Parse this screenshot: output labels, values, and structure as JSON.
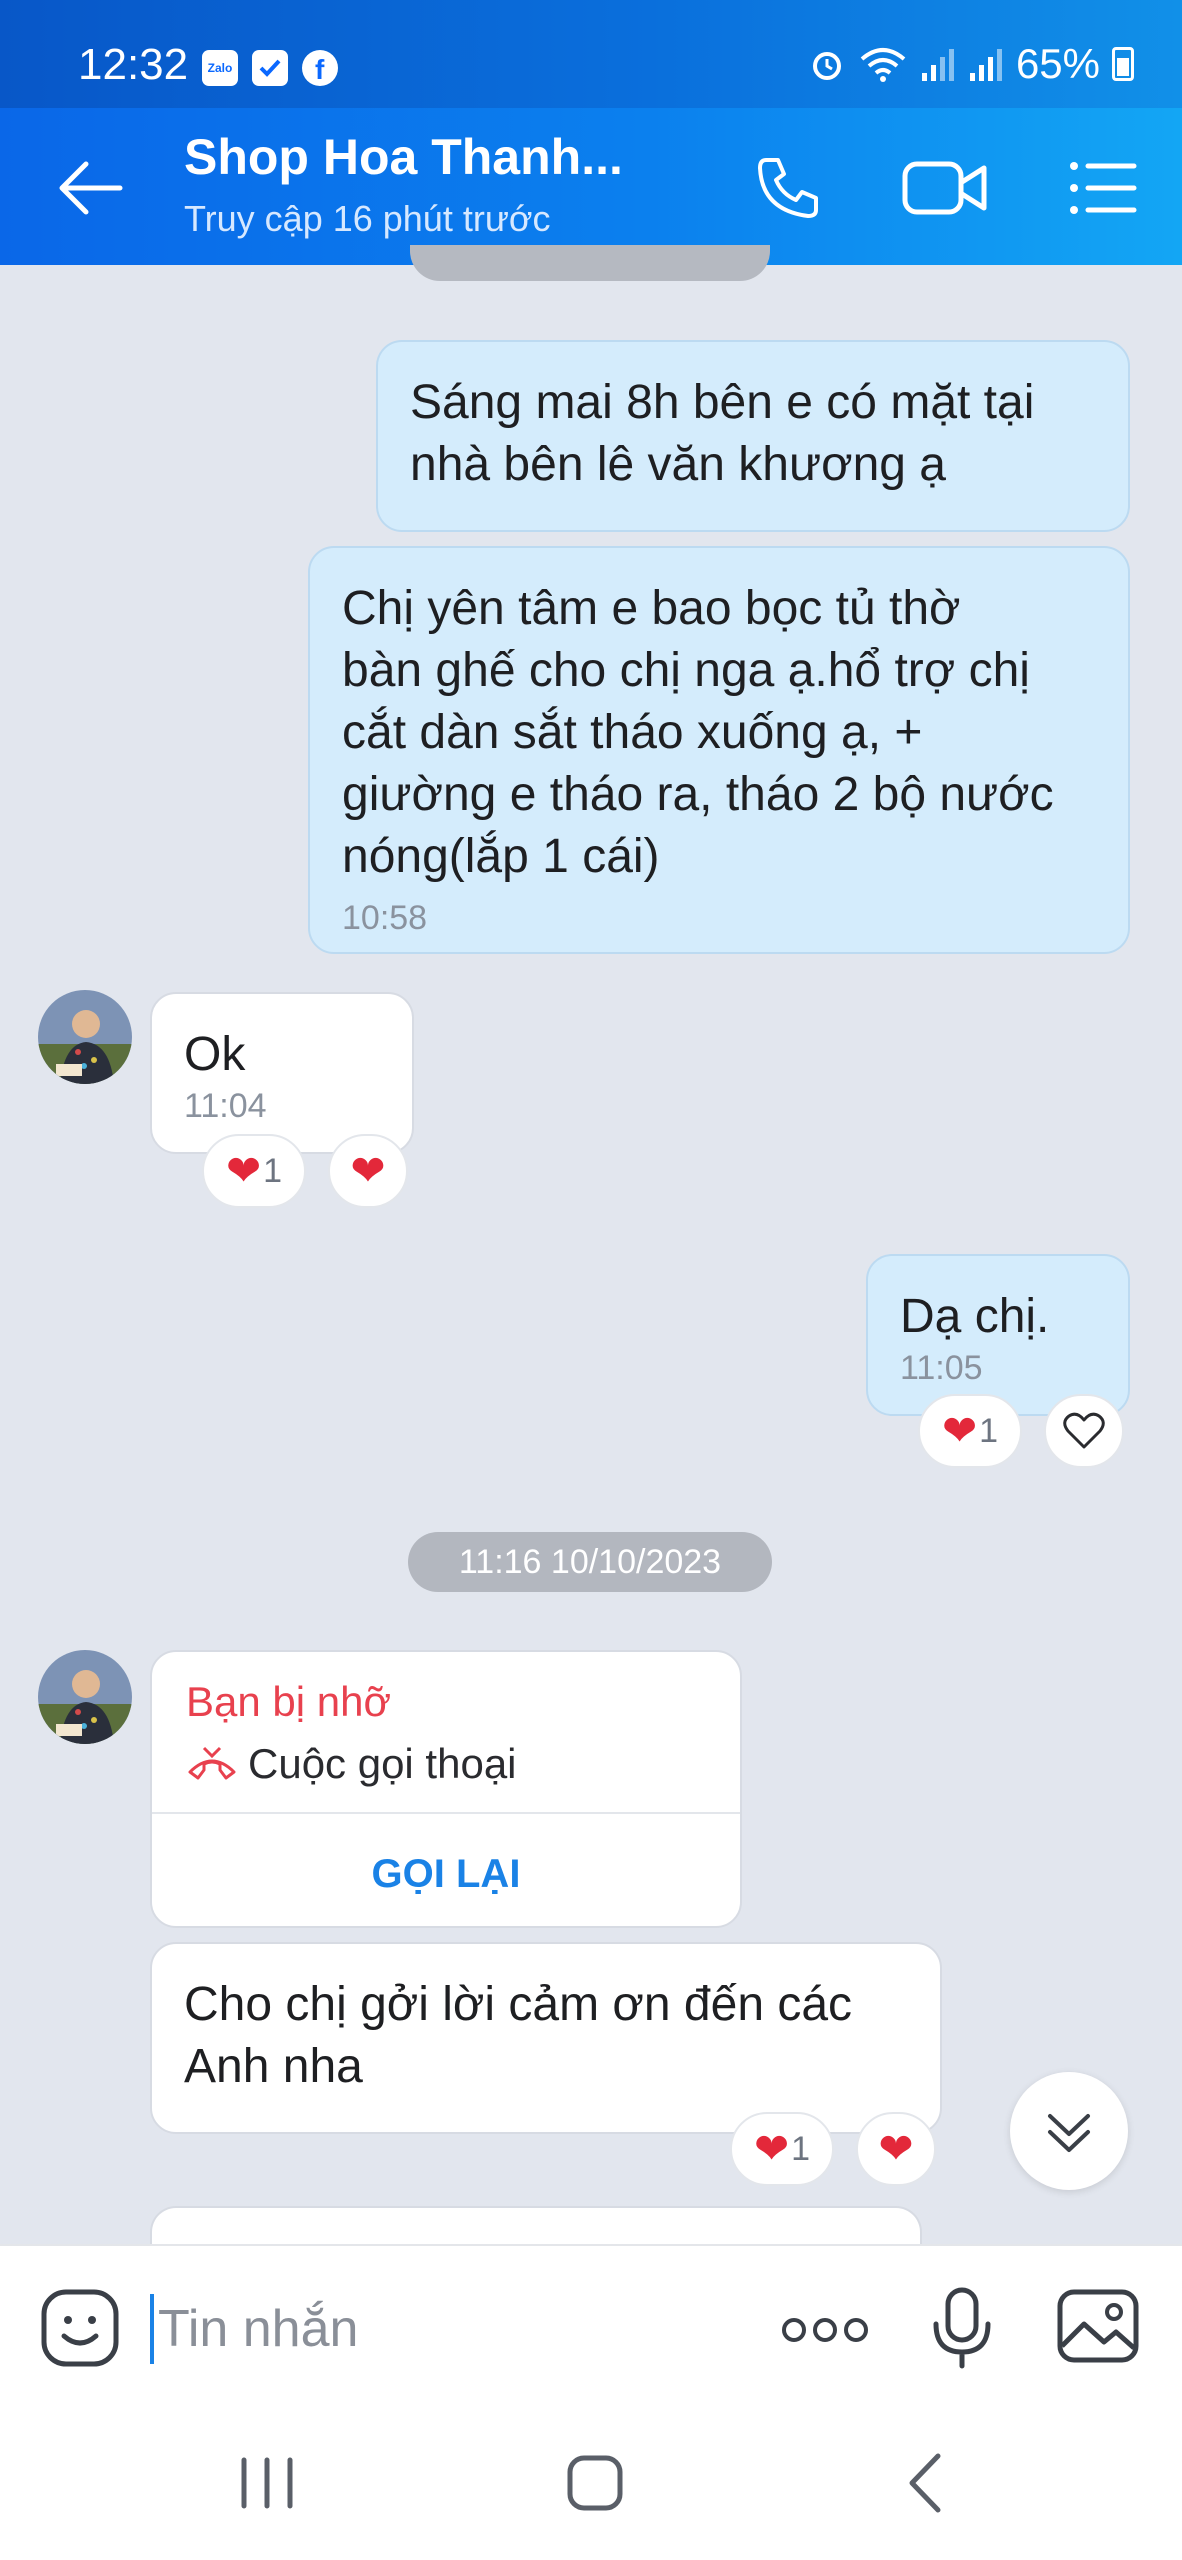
{
  "status_bar": {
    "time": "12:32",
    "battery": "65%",
    "app_badge_text": "Zalo"
  },
  "header": {
    "title": "Shop Hoa Thanh...",
    "subtitle": "Truy cập 16 phút trước"
  },
  "messages": [
    {
      "side": "mine",
      "text_lines": [
        "Sáng mai 8h bên e có mặt tại",
        "nhà bên lê văn khương ạ"
      ]
    },
    {
      "side": "mine",
      "text_lines": [
        "Chị yên tâm e bao bọc tủ thờ",
        "bàn ghế cho chị nga ạ.hổ trợ chị",
        "cắt dàn sắt tháo xuống ạ, +",
        "giường e tháo ra, tháo 2 bộ nước",
        "nóng(lắp 1 cái)"
      ],
      "time": "10:58"
    },
    {
      "side": "theirs",
      "text": "Ok",
      "time": "11:04",
      "reaction_count": "1"
    },
    {
      "side": "mine",
      "text": "Dạ chị.",
      "time": "11:05",
      "reaction_count": "1"
    },
    {
      "side": "theirs",
      "text_lines": [
        "Cho chị gởi lời cảm ơn đến các",
        "Anh nha"
      ],
      "reaction_count": "1"
    }
  ],
  "date_separator": "11:16 10/10/2023",
  "missed_call": {
    "title": "Bạn bị nhỡ",
    "label": "Cuộc gọi thoại",
    "action": "GỌI LẠI"
  },
  "composer": {
    "placeholder": "Tin nhắn"
  },
  "colors": {
    "header": "#0b80ee",
    "mine_bubble": "#d4ecfc",
    "theirs_bubble": "#ffffff",
    "missed_red": "#e8414e",
    "link_blue": "#1a82e6",
    "heart": "#e3283a"
  }
}
